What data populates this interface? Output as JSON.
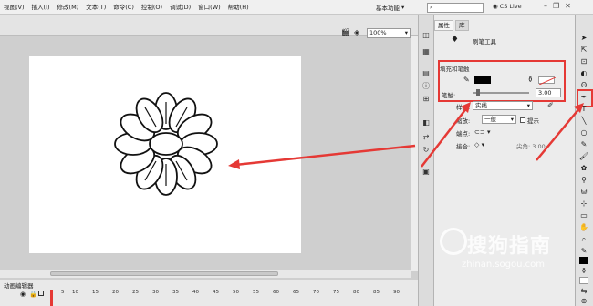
{
  "menubar": {
    "items": [
      "视图(V)",
      "插入(I)",
      "修改(M)",
      "文本(T)",
      "命令(C)",
      "控制(O)",
      "调试(D)",
      "窗口(W)",
      "帮助(H)"
    ],
    "workspace": "基本功能",
    "search_placeholder": "",
    "cs_live": "CS Live"
  },
  "stage": {
    "zoom": "100%"
  },
  "timeline": {
    "tab_label": "动画编辑器",
    "frames": [
      "1",
      "5",
      "10",
      "15",
      "20",
      "25",
      "30",
      "35",
      "40",
      "45",
      "50",
      "55",
      "60",
      "65",
      "70",
      "75",
      "80",
      "85",
      "90"
    ]
  },
  "props": {
    "tabs": [
      "属性",
      "库"
    ],
    "tool_name": "刷笔工具",
    "section_title": "填充和笔触",
    "size_label": "笔触:",
    "size_value": "3.00",
    "style_label": "样式:",
    "style_value": "实线",
    "scale_label": "缩放:",
    "scale_value": "一般",
    "hint_label": "提示",
    "cap_label": "端点:",
    "join_label": "接合:",
    "miter_label": "尖角:",
    "miter_value": "3.00",
    "colors": {
      "stroke": "#000000",
      "fill": "#ffffff"
    }
  },
  "annotation": {
    "color": "#e53935"
  },
  "watermark": {
    "text": "搜狗指南",
    "url": "zhinan.sogou.com"
  }
}
